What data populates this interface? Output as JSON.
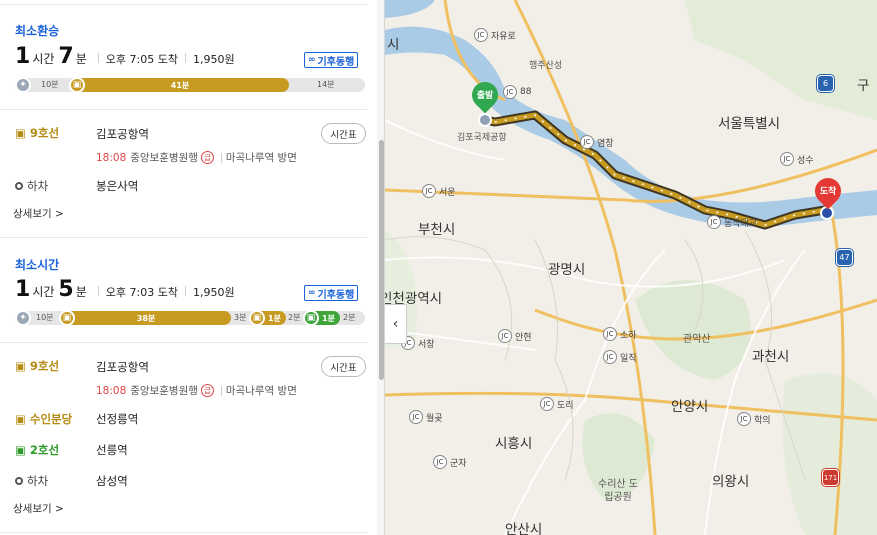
{
  "routes": [
    {
      "category": "최소환승",
      "hours": "1",
      "hours_unit": "시간",
      "minutes": "7",
      "minutes_unit": "분",
      "arrival": "오후 7:05 도착",
      "fare": "1,950원",
      "weather_tag": "기후동행",
      "bar": {
        "walk_label": "10분",
        "subway_label": "41분",
        "end_label": "14분"
      },
      "steps": [
        {
          "line": "9호선",
          "station": "김포공항역",
          "timetable": "시간표",
          "time": "18:08",
          "dest": "중앙보훈병원행",
          "rapid": "급",
          "direction": "마곡나루역 방면"
        },
        {
          "line": "하차",
          "station": "봉은사역"
        }
      ],
      "more": "상세보기 >"
    },
    {
      "category": "최소시간",
      "hours": "1",
      "hours_unit": "시간",
      "minutes": "5",
      "minutes_unit": "분",
      "arrival": "오후 7:03 도착",
      "fare": "1,950원",
      "weather_tag": "기후동행",
      "bar": {
        "walk_label": "10분",
        "subway_label": "38분",
        "gap1": "3분",
        "seg2_label": "1분",
        "gap2": "2분",
        "seg3_label": "1분",
        "gap3": "2분"
      },
      "steps": [
        {
          "line": "9호선",
          "station": "김포공항역",
          "timetable": "시간표",
          "time": "18:08",
          "dest": "중앙보훈병원행",
          "rapid": "급",
          "direction": "마곡나루역 방면"
        },
        {
          "line": "수인분당",
          "station": "선정릉역"
        },
        {
          "line": "2호선",
          "station": "선릉역"
        },
        {
          "line": "하차",
          "station": "삼성역"
        }
      ],
      "more": "상세보기 >"
    }
  ],
  "map": {
    "cities": [
      {
        "name": "서울특별시"
      },
      {
        "name": "부천시"
      },
      {
        "name": "광명시"
      },
      {
        "name": "과천시"
      },
      {
        "name": "안양시"
      },
      {
        "name": "시흥시"
      },
      {
        "name": "의왕시"
      },
      {
        "name": "안산시"
      },
      {
        "name": "인천광역시"
      },
      {
        "name": "구"
      },
      {
        "name": "시"
      }
    ],
    "junctions": [
      "자유로",
      "88",
      "서운",
      "염창",
      "동작대교",
      "성수",
      "소하",
      "안현",
      "일직",
      "도리",
      "월곶",
      "군자",
      "학의",
      "서창"
    ],
    "small_labels": [
      "행주산성",
      "김포국제공항",
      "관악산",
      "수리산 도립공원"
    ],
    "highways": [
      "6",
      "47",
      "171"
    ],
    "start_pin": "출발",
    "end_pin": "도착",
    "route_color": "#c79b22"
  },
  "colors": {
    "accent_blue": "#1a62d8",
    "line9_gold": "#c79b22",
    "line2_green": "#3ea53a",
    "rapid_red": "#e04646",
    "start_green": "#2fa84f",
    "end_red": "#e53935"
  }
}
